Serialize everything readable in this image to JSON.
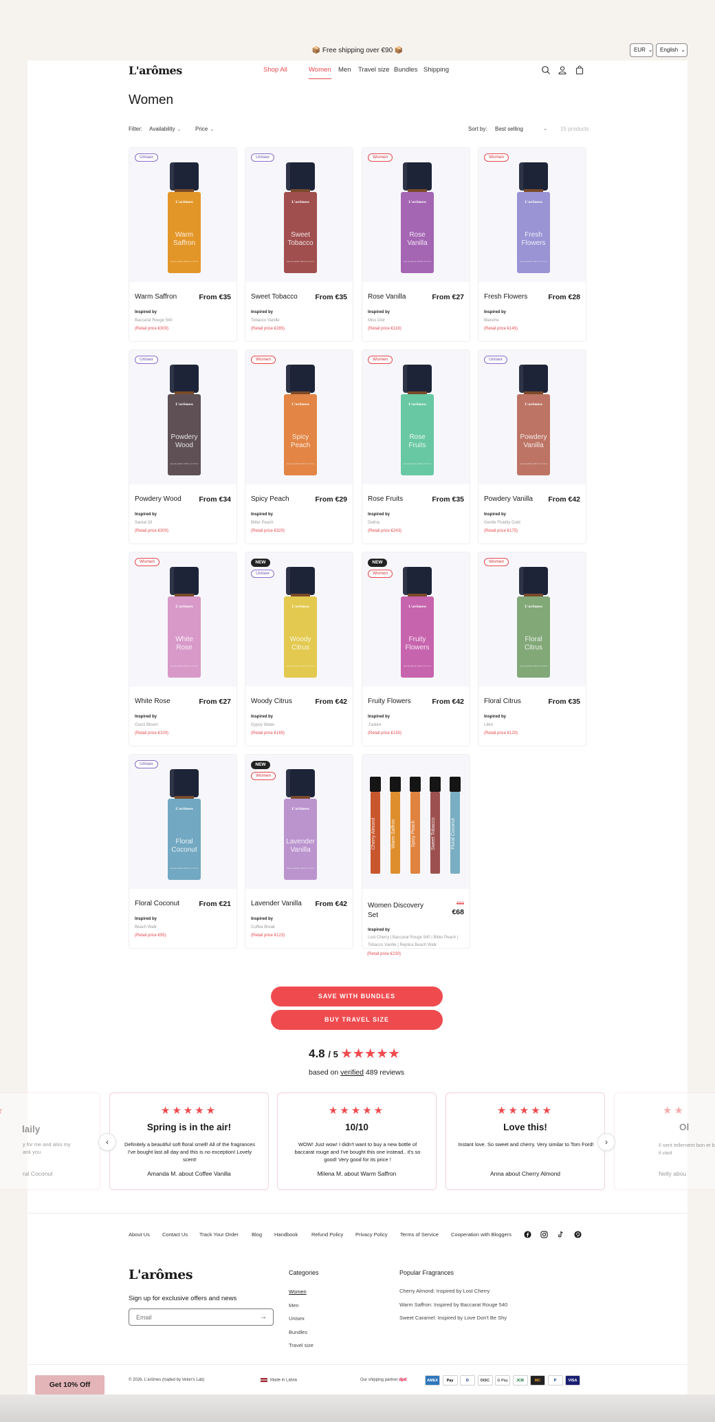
{
  "announcement": "📦 Free shipping over €90 📦",
  "currency": "EUR",
  "language": "English",
  "logo": "L'arômes",
  "nav": {
    "shop_all": "Shop All",
    "women": "Women",
    "men": "Men",
    "travel": "Travel size",
    "bundles": "Bundles",
    "shipping": "Shipping"
  },
  "page_title": "Women",
  "filters": {
    "label": "Filter:",
    "availability": "Availability",
    "price": "Price",
    "sort_label": "Sort by:",
    "sort_value": "Best selling",
    "count": "15 products"
  },
  "bottle_brand": "L'arômes",
  "bottle_fine": "eau de parfum 30ml e 1.0 fl oz",
  "inspired_label": "Inspired by",
  "products": [
    {
      "name": "Warm Saffron",
      "label_line1": "Warm",
      "label_line2": "Saffron",
      "price": "From €35",
      "inspired": "Baccarat Rouge 540",
      "retail": "(Retail price €300)",
      "category": "Unisex",
      "new": "",
      "color": "#e39628"
    },
    {
      "name": "Sweet Tobacco",
      "label_line1": "Sweet",
      "label_line2": "Tobacco",
      "price": "From €35",
      "inspired": "Tobacco Vanille",
      "retail": "(Retail price €285)",
      "category": "Unisex",
      "new": "",
      "color": "#a04f4e"
    },
    {
      "name": "Rose Vanilla",
      "label_line1": "Rose",
      "label_line2": "Vanilla",
      "price": "From €27",
      "inspired": "Miss Dior",
      "retail": "(Retail price €118)",
      "category": "Women",
      "new": "",
      "color": "#a465b3"
    },
    {
      "name": "Fresh Flowers",
      "label_line1": "Fresh",
      "label_line2": "Flowers",
      "price": "From €28",
      "inspired": "Blanche",
      "retail": "(Retail price €145)",
      "category": "Women",
      "new": "",
      "color": "#9a93d4"
    },
    {
      "name": "Powdery Wood",
      "label_line1": "Powdery",
      "label_line2": "Wood",
      "price": "From €34",
      "inspired": "Santal 33",
      "retail": "(Retail price €300)",
      "category": "Unisex",
      "new": "",
      "color": "#5e5055"
    },
    {
      "name": "Spicy Peach",
      "label_line1": "Spicy",
      "label_line2": "Peach",
      "price": "From €29",
      "inspired": "Bitter Peach",
      "retail": "(Retail price €320)",
      "category": "Women",
      "new": "",
      "color": "#e28545"
    },
    {
      "name": "Rose Fruits",
      "label_line1": "Rose",
      "label_line2": "Fruits",
      "price": "From €35",
      "inspired": "Delina",
      "retail": "(Retail price €243)",
      "category": "Women",
      "new": "",
      "color": "#69c8a4"
    },
    {
      "name": "Powdery Vanilla",
      "label_line1": "Powdery",
      "label_line2": "Vanilla",
      "price": "From €42",
      "inspired": "Gentle Fluidity Gold",
      "retail": "(Retail price €175)",
      "category": "Unisex",
      "new": "",
      "color": "#bd7464"
    },
    {
      "name": "White Rose",
      "label_line1": "White",
      "label_line2": "Rose",
      "price": "From €27",
      "inspired": "Gucci Bloom",
      "retail": "(Retail price €100)",
      "category": "Women",
      "new": "",
      "color": "#d899c9"
    },
    {
      "name": "Woody Citrus",
      "label_line1": "Woody",
      "label_line2": "Citrus",
      "price": "From €42",
      "inspired": "Gypsy Water",
      "retail": "(Retail price €165)",
      "category": "Unisex",
      "new": "NEW",
      "color": "#e3c94f"
    },
    {
      "name": "Fruity Flowers",
      "label_line1": "Fruity",
      "label_line2": "Flowers",
      "price": "From €42",
      "inspired": "J'adore",
      "retail": "(Retail price €150)",
      "category": "Women",
      "new": "NEW",
      "color": "#c764ae"
    },
    {
      "name": "Floral Citrus",
      "label_line1": "Floral",
      "label_line2": "Citrus",
      "price": "From €35",
      "inspired": "Libre",
      "retail": "(Retail price €120)",
      "category": "Women",
      "new": "",
      "color": "#82a878"
    },
    {
      "name": "Floral Coconut",
      "label_line1": "Floral",
      "label_line2": "Coconut",
      "price": "From €21",
      "inspired": "Beach Walk",
      "retail": "(Retail price €95)",
      "category": "Unisex",
      "new": "",
      "color": "#72a8c1"
    },
    {
      "name": "Lavender Vanilla",
      "label_line1": "Lavender",
      "label_line2": "Vanilla",
      "price": "From €42",
      "inspired": "Coffee Break",
      "retail": "(Retail price €123)",
      "category": "Women",
      "new": "NEW",
      "color": "#bb94ce"
    }
  ],
  "discovery_set": {
    "name_line1": "Women Discovery",
    "name_line2": "Set",
    "old_price": "€93",
    "price": "€68",
    "inspired_line1": "Lost Cherry | Baccarat Rouge 540 | Bitter Peach |",
    "inspired_line2": "Tobacco Vanille | Replica Beach Walk",
    "retail": "(Retail price €230)",
    "minis": [
      {
        "label": "Cherry Almond",
        "color": "#c9572e"
      },
      {
        "label": "Warm Saffron",
        "color": "#df8e2e"
      },
      {
        "label": "Spicy Peach",
        "color": "#e0833f"
      },
      {
        "label": "Sweet Tobacco",
        "color": "#9c5150"
      },
      {
        "label": "Floral Coconut",
        "color": "#7aaec2"
      }
    ]
  },
  "buttons": {
    "bundles": "SAVE WITH BUNDLES",
    "travel": "BUY TRAVEL SIZE"
  },
  "rating": {
    "score": "4.8",
    "out_of": "/ 5",
    "stars": "★★★★★",
    "based_prefix": "based on",
    "verified": "verified",
    "count": "489 reviews"
  },
  "reviews": [
    {
      "stars": "★★",
      "title": "",
      "body": "laily",
      "body2": "y for me and also my",
      "body3": "ank you",
      "author": "ral Coconut"
    },
    {
      "stars": "★★★★★",
      "title": "Spring is in the air!",
      "body": "Definitely a beautiful soft floral smell! All of the fragrances I've bought last all day and this is no exception! Lovely scent!",
      "author": "Amanda M. about Coffee Vanilla"
    },
    {
      "stars": "★★★★★",
      "title": "10/10",
      "body": "WOW! Just wow! I didn't want to buy a new bottle of baccarat rouge and I've bought this one instead.. it's so good! Very good for its price !",
      "author": "Milena M. about Warm Saffron"
    },
    {
      "stars": "★★★★★",
      "title": "Love this!",
      "body": "Instant love. So sweet and cherry. Very similar to Tom Ford!",
      "author": "Anna about Cherry Almond"
    },
    {
      "stars": "★★",
      "title": "Ol",
      "body": "Il sent tellement bon et b",
      "body2": "il vaut",
      "author": "Nelly abou"
    }
  ],
  "footer": {
    "links": [
      "About Us",
      "Contact Us",
      "Track Your Order",
      "Blog",
      "Handbook",
      "Refund Policy",
      "Privacy Policy",
      "Terms of Service",
      "Cooperation with Bloggers"
    ],
    "signup": "Sign up for exclusive offers and news",
    "email_placeholder": "Email",
    "categories_title": "Categories",
    "categories": [
      "Women",
      "Men",
      "Unisex",
      "Bundles",
      "Travel size"
    ],
    "popular_title": "Popular Fragrances",
    "popular": [
      "Cherry Almond: Inspired by Lost Cherry",
      "Warm Saffron: Inspired by Baccarat Rouge 540",
      "Sweet Caramel: Inspired by Love Don't Be Shy"
    ],
    "copyright": "© 2026, L'arômes (traded by Velon's Lab)",
    "made_in": "Made in Latvia",
    "shipping_partner": "Our shipping partner",
    "dpd": "dpd",
    "offer": "Get 10% Off",
    "payments": [
      "AMEX",
      "Pay",
      "D",
      "DISC",
      "G Pay",
      "JCB",
      "MC",
      "P",
      "VISA"
    ]
  },
  "colors": {
    "accent": "#ef4b4f",
    "text": "#1a1a1a",
    "background": "#f6f3ef"
  }
}
